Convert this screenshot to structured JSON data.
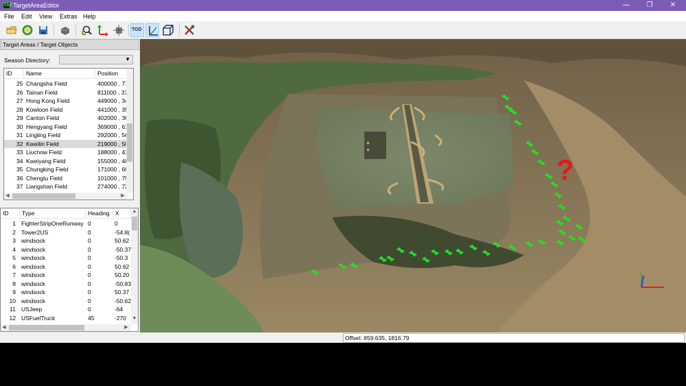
{
  "window": {
    "title": "TargetAreaEditor",
    "icon_text": "TAE",
    "controls": [
      "—",
      "❐",
      "✕"
    ]
  },
  "menu": [
    "File",
    "Edit",
    "View",
    "Extras",
    "Help"
  ],
  "toolbar": {
    "tod_label": "TOD",
    "icons": [
      "open-folder-icon",
      "refresh-icon",
      "save-icon",
      "object-icon",
      "zoom-search-icon",
      "axis-move-icon",
      "terrain-object-icon",
      "tod-icon",
      "axes-view-icon",
      "box-view-icon",
      "tools-icon"
    ]
  },
  "left_panel": {
    "title": "Target Areas / Target Objects",
    "season_label": "Season Directory:",
    "season_value": "",
    "areas": {
      "columns": [
        "ID",
        "Name",
        "Position"
      ],
      "rows": [
        [
          "25",
          "Changsha Field",
          "400000 , 77"
        ],
        [
          "26",
          "Tainan Field",
          "811000 , 37"
        ],
        [
          "27",
          "Hong Kong Field",
          "449000 , 34"
        ],
        [
          "28",
          "Kowloon Field",
          "441000 , 35"
        ],
        [
          "29",
          "Canton Field",
          "402000 , 36"
        ],
        [
          "30",
          "Hengyang Field",
          "369000 , 61"
        ],
        [
          "31",
          "Lingling Field",
          "292000 , 56"
        ],
        [
          "32",
          "Kweilin Field",
          "219000 , 50"
        ],
        [
          "33",
          "Liuchow Field",
          "188000 , 43"
        ],
        [
          "34",
          "Kweiyang Field",
          "155000 , 48"
        ],
        [
          "35",
          "Chungking Field",
          "171000 , 66"
        ],
        [
          "36",
          "Chengtu Field",
          "101000 , 75"
        ],
        [
          "37",
          "Liangshan Field",
          "274000 , 72"
        ]
      ],
      "selected_id": "32"
    },
    "objects": {
      "columns": [
        "ID",
        "Type",
        "Heading",
        "X"
      ],
      "rows": [
        [
          "1",
          "FighterStripOneRunway",
          "0",
          "0"
        ],
        [
          "2",
          "Tower2US",
          "0",
          "-54.8("
        ],
        [
          "3",
          "windsock",
          "0",
          "50.62"
        ],
        [
          "4",
          "windsock",
          "0",
          "-50.37"
        ],
        [
          "5",
          "windsock",
          "0",
          "-50.3"
        ],
        [
          "6",
          "windsock",
          "0",
          "50.62"
        ],
        [
          "7",
          "windsock",
          "0",
          "50.20"
        ],
        [
          "8",
          "windsock",
          "0",
          "-50.83"
        ],
        [
          "9",
          "windsock",
          "0",
          "50.37"
        ],
        [
          "10",
          "windsock",
          "0",
          "-50.62"
        ],
        [
          "11",
          "USJeep",
          "0",
          "-64"
        ],
        [
          "12",
          "USFuelTruck",
          "45",
          "-270"
        ]
      ]
    }
  },
  "viewport": {
    "annotation": "?",
    "colors": {
      "marker": "#22e022",
      "question": "#e01b1b",
      "runway": "#5a5a44"
    }
  },
  "status": {
    "offset_text": "Offset: 859.635, 1816.79"
  }
}
